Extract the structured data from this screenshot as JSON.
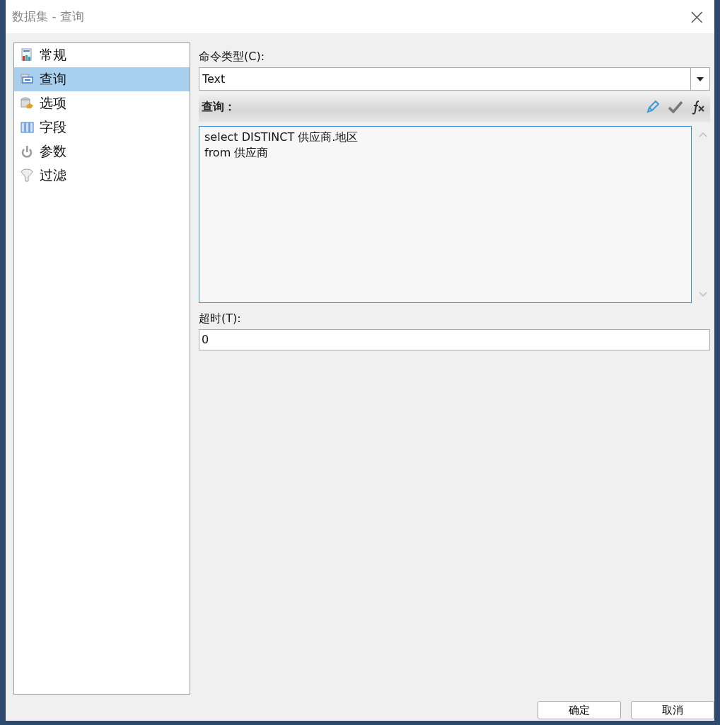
{
  "window": {
    "title": "数据集 - 查询",
    "close": "×"
  },
  "sidebar": {
    "items": [
      {
        "label": "常规",
        "selected": false
      },
      {
        "label": "查询",
        "selected": true
      },
      {
        "label": "选项",
        "selected": false
      },
      {
        "label": "字段",
        "selected": false
      },
      {
        "label": "参数",
        "selected": false
      },
      {
        "label": "过滤",
        "selected": false
      }
    ]
  },
  "command_type": {
    "label": "命令类型(C):",
    "value": "Text"
  },
  "query": {
    "label": "查询：",
    "text": [
      "select DISTINCT 供应商.地区",
      "from 供应商"
    ]
  },
  "timeout": {
    "label": "超时(T):",
    "value": "0"
  },
  "buttons": [
    "确定",
    "取消"
  ]
}
